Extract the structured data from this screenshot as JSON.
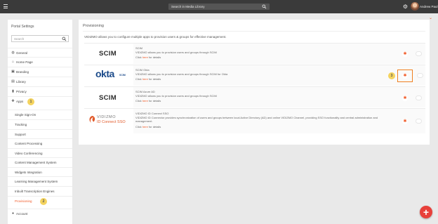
{
  "topbar": {
    "search_placeholder": "Search in Media Library",
    "user_name": "Andrew Paul"
  },
  "sidebar": {
    "title": "Portal Settings",
    "search_placeholder": "Search",
    "items": [
      {
        "label": "General",
        "icon": "globe-icon"
      },
      {
        "label": "Home Page",
        "icon": "home-icon"
      },
      {
        "label": "Branding",
        "icon": "image-icon"
      },
      {
        "label": "Library",
        "icon": "book-icon"
      },
      {
        "label": "Privacy",
        "icon": "lock-icon"
      },
      {
        "label": "Apps",
        "icon": "puzzle-icon"
      }
    ],
    "apps_badge": "1",
    "sub_items": [
      {
        "label": "Single Sign-On"
      },
      {
        "label": "Tracking"
      },
      {
        "label": "Support"
      },
      {
        "label": "Content Processing"
      },
      {
        "label": "Video Conferencing"
      },
      {
        "label": "Content Management System"
      },
      {
        "label": "Widgets Integration"
      },
      {
        "label": "Learning Management System"
      },
      {
        "label": "Inbuilt Transcription Engines"
      },
      {
        "label": "Provisioning"
      }
    ],
    "provisioning_badge": "2",
    "account_label": "Account"
  },
  "main": {
    "title": "Provisioning",
    "description": "VIDIZMO allows you to configure multiple apps to provision users & groups for effective management.",
    "click_prefix": "Click ",
    "click_link": "here",
    "click_suffix": " for details",
    "providers": [
      {
        "logo": "SCIM",
        "name": "SCIM",
        "desc": "VIDIZMO allows you to provision users and groups through SCIM"
      },
      {
        "logo": "okta",
        "logo_sub": "SCIM",
        "name": "SCIM Okta",
        "desc": "VIDIZMO allows you to provision users and groups through SCIM for Okta"
      },
      {
        "logo": "SCIM",
        "name": "SCIM Azure AD",
        "desc": "VIDIZMO allows you to provision users and groups through SCIM"
      },
      {
        "logo": "VIDIZMO",
        "logo_sub": "ID Connect SSO",
        "name": "VIDIZMO ID Connect SSO",
        "desc": "VIDIZMO ID Connector provides synchronization of users and groups between local Active Directory (AD) and online VIDIZMO Channel, providing SSO functionality and central administration and management."
      }
    ],
    "okta_badge": "3"
  },
  "colors": {
    "accent": "#f05a28",
    "topbar": "#3a3a3a",
    "badge": "#f4d35e",
    "fab": "#e8403a"
  }
}
